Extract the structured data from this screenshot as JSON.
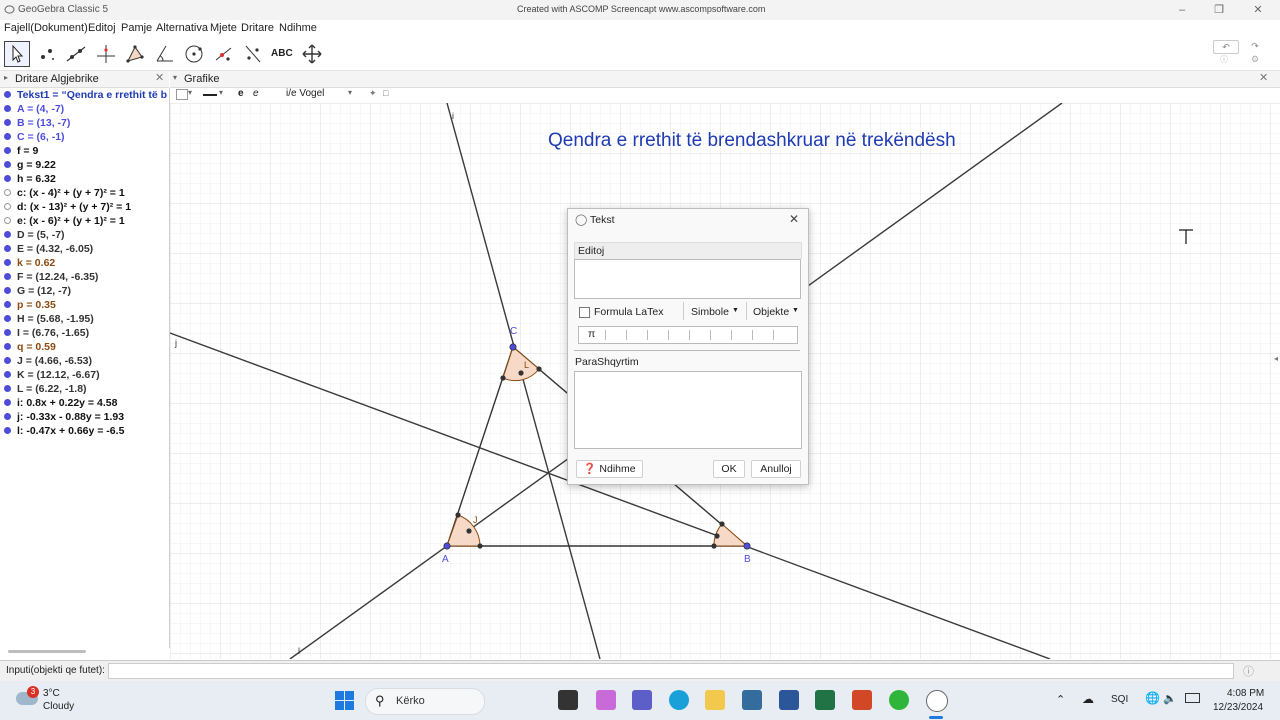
{
  "window": {
    "title": "GeoGebra Classic 5",
    "watermark": "Created with ASCOMP Screencapt www.ascompsoftware.com"
  },
  "menu": [
    "Fajell(Dokument)",
    "Editoj",
    "Pamje",
    "Alternativa",
    "Mjete",
    "Dritare",
    "Ndihme"
  ],
  "toolbar": {
    "tools": [
      "move-tool-icon",
      "point-tool-icon",
      "line-tool-icon",
      "perpendicular-tool-icon",
      "polygon-tool-icon",
      "angle-tool-icon",
      "circle-tool-icon",
      "conic-tool-icon",
      "reflect-tool-icon",
      "text-tool-icon",
      "move-view-tool-icon"
    ],
    "text_tool_label": "ABC"
  },
  "algebra": {
    "title": "Dritare Algjebrike",
    "items": [
      {
        "text": "Tekst1 = “Qendra e rrethit të b",
        "color": "#1f3bb3",
        "filled": true
      },
      {
        "text": "A = (4, -7)",
        "color": "#4d4dd9",
        "filled": true
      },
      {
        "text": "B = (13, -7)",
        "color": "#4d4dd9",
        "filled": true
      },
      {
        "text": "C = (6, -1)",
        "color": "#4d4dd9",
        "filled": true
      },
      {
        "text": "f = 9",
        "color": "#111111",
        "filled": true
      },
      {
        "text": "g = 9.22",
        "color": "#111111",
        "filled": true
      },
      {
        "text": "h = 6.32",
        "color": "#111111",
        "filled": true
      },
      {
        "text": "c: (x - 4)² + (y + 7)² = 1",
        "color": "#111111",
        "filled": false
      },
      {
        "text": "d: (x - 13)² + (y + 7)² = 1",
        "color": "#111111",
        "filled": false
      },
      {
        "text": "e: (x - 6)² + (y + 1)² = 1",
        "color": "#111111",
        "filled": false
      },
      {
        "text": "D = (5, -7)",
        "color": "#333333",
        "filled": true
      },
      {
        "text": "E = (4.32, -6.05)",
        "color": "#333333",
        "filled": true
      },
      {
        "text": "k = 0.62",
        "color": "#8a4a10",
        "filled": true
      },
      {
        "text": "F = (12.24, -6.35)",
        "color": "#333333",
        "filled": true
      },
      {
        "text": "G = (12, -7)",
        "color": "#333333",
        "filled": true
      },
      {
        "text": "p = 0.35",
        "color": "#8a4a10",
        "filled": true
      },
      {
        "text": "H = (5.68, -1.95)",
        "color": "#333333",
        "filled": true
      },
      {
        "text": "I = (6.76, -1.65)",
        "color": "#333333",
        "filled": true
      },
      {
        "text": "q = 0.59",
        "color": "#8a4a10",
        "filled": true
      },
      {
        "text": "J = (4.66, -6.53)",
        "color": "#333333",
        "filled": true
      },
      {
        "text": "K = (12.12, -6.67)",
        "color": "#333333",
        "filled": true
      },
      {
        "text": "L = (6.22, -1.8)",
        "color": "#333333",
        "filled": true
      },
      {
        "text": "i: 0.8x + 0.22y = 4.58",
        "color": "#111111",
        "filled": true
      },
      {
        "text": "j: -0.33x - 0.88y = 1.93",
        "color": "#111111",
        "filled": true
      },
      {
        "text": "l: -0.47x + 0.66y = -6.5",
        "color": "#111111",
        "filled": true
      }
    ]
  },
  "graphics": {
    "title": "Grafike",
    "style_bar": {
      "bold": "e",
      "italic": "e",
      "size": "i/e Vogel"
    },
    "heading": "Qendra e rrethit të brendashkruar në trekëndësh",
    "heading_color": "#1f3bb3",
    "labels": {
      "A": "A",
      "B": "B",
      "C": "C",
      "i": "i",
      "j": "j",
      "l": "l",
      "L": "L",
      "J": "J"
    }
  },
  "dialog": {
    "title": "Tekst",
    "edit_label": "Editoj",
    "latex_label": "Formula LaTex",
    "latex_checked": false,
    "symbols_label": "Simbole",
    "objects_label": "Objekte",
    "pi_symbol": "π",
    "preview_label": "ParaShqyrtim",
    "help_label": "Ndihme",
    "ok_label": "OK",
    "cancel_label": "Anulloj"
  },
  "inputbar": {
    "label": "Inputi(objekti qe futet):"
  },
  "taskbar": {
    "weather_temp": "3°C",
    "weather_desc": "Cloudy",
    "weather_badge": "3",
    "search_placeholder": "Kërko",
    "language": "SQI",
    "time": "4:08 PM",
    "date": "12/23/2024"
  }
}
